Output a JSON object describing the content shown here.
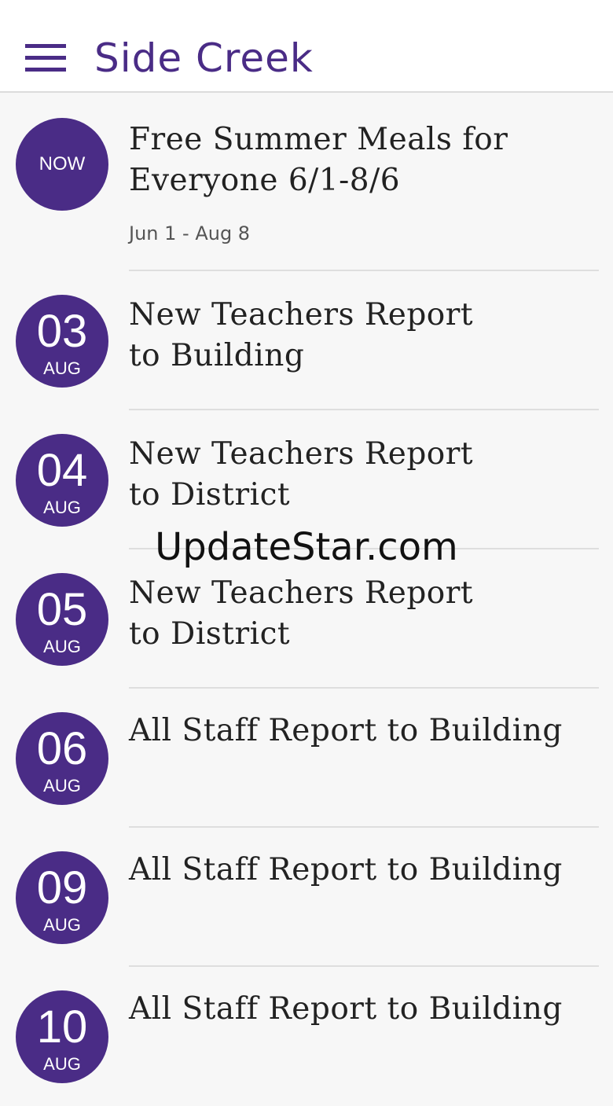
{
  "header": {
    "title": "Side Creek",
    "menu_icon": "hamburger-menu-icon"
  },
  "colors": {
    "accent": "#4a2c86",
    "background": "#f7f7f7",
    "divider": "#dedede"
  },
  "events": [
    {
      "badge_text": "NOW",
      "title_line1": "Free Summer Meals for",
      "title_line2": "Everyone 6/1-8/6",
      "date_range": "Jun 1 - Aug 8"
    },
    {
      "day": "03",
      "month": "AUG",
      "title_line1": "New Teachers Report",
      "title_line2": "to Building"
    },
    {
      "day": "04",
      "month": "AUG",
      "title_line1": "New Teachers Report",
      "title_line2": "to District"
    },
    {
      "day": "05",
      "month": "AUG",
      "title_line1": "New Teachers Report",
      "title_line2": "to District"
    },
    {
      "day": "06",
      "month": "AUG",
      "title_line1": "All Staff Report to Building"
    },
    {
      "day": "09",
      "month": "AUG",
      "title_line1": "All Staff Report to Building"
    },
    {
      "day": "10",
      "month": "AUG",
      "title_line1": "All Staff Report to Building"
    }
  ],
  "watermark": "UpdateStar.com"
}
